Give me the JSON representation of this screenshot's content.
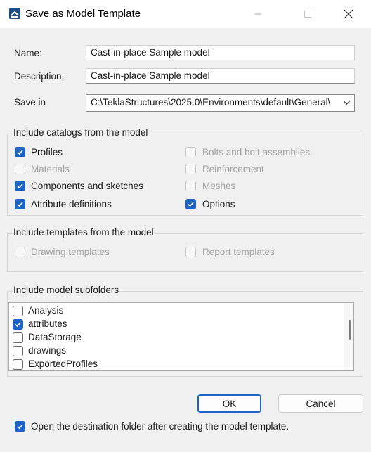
{
  "window": {
    "title": "Save as Model Template"
  },
  "colors": {
    "accent": "#1d62c7",
    "window_bg": "#f0f0f0",
    "disabled_text": "#a0a0a0"
  },
  "form": {
    "name_label": "Name:",
    "name_value": "Cast-in-place Sample model",
    "description_label": "Description:",
    "description_value": "Cast-in-place Sample model",
    "save_in_label": "Save in",
    "save_in_value": "C:\\TeklaStructures\\2025.0\\Environments\\default\\General\\"
  },
  "catalogs": {
    "title": "Include catalogs from the model",
    "items": [
      {
        "label": "Profiles",
        "checked": true,
        "enabled": true
      },
      {
        "label": "Materials",
        "checked": false,
        "enabled": false
      },
      {
        "label": "Components and sketches",
        "checked": true,
        "enabled": true
      },
      {
        "label": "Attribute definitions",
        "checked": true,
        "enabled": true
      },
      {
        "label": "Bolts and bolt assemblies",
        "checked": false,
        "enabled": false
      },
      {
        "label": "Reinforcement",
        "checked": false,
        "enabled": false
      },
      {
        "label": "Meshes",
        "checked": false,
        "enabled": false
      },
      {
        "label": "Options",
        "checked": true,
        "enabled": true
      }
    ]
  },
  "templates": {
    "title": "Include templates from the model",
    "items": [
      {
        "label": "Drawing templates",
        "checked": false,
        "enabled": false
      },
      {
        "label": "Report templates",
        "checked": false,
        "enabled": false
      }
    ]
  },
  "subfolders": {
    "title": "Include model subfolders",
    "items": [
      {
        "label": "Analysis",
        "checked": false
      },
      {
        "label": "attributes",
        "checked": true
      },
      {
        "label": "DataStorage",
        "checked": false
      },
      {
        "label": "drawings",
        "checked": false
      },
      {
        "label": "ExportedProfiles",
        "checked": false
      }
    ]
  },
  "buttons": {
    "ok": "OK",
    "cancel": "Cancel"
  },
  "footer": {
    "open_folder_label": "Open the destination folder after creating the model template.",
    "open_folder_checked": true
  }
}
